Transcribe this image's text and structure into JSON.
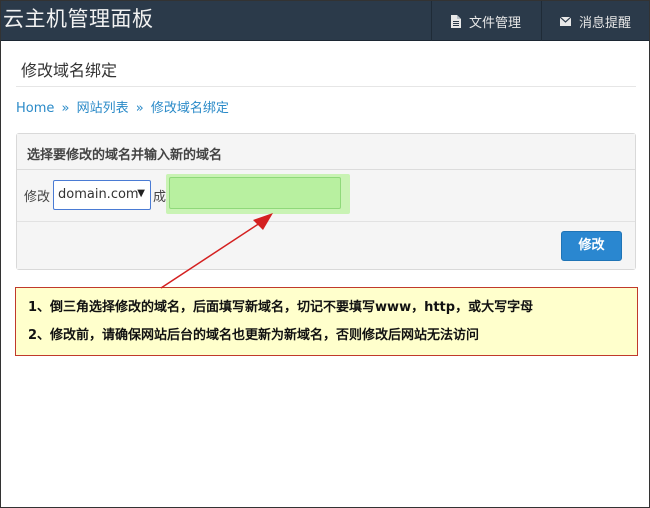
{
  "navbar": {
    "brand": "云主机管理面板",
    "files_label": "文件管理",
    "messages_label": "消息提醒"
  },
  "page": {
    "title": "修改域名绑定"
  },
  "breadcrumb": {
    "home": "Home",
    "sep1": "»",
    "sites": "网站列表",
    "sep2": "»",
    "current": "修改域名绑定"
  },
  "form": {
    "heading": "选择要修改的域名并输入新的域名",
    "modify_label": "修改",
    "selected_domain": "domain.com",
    "to_label": "成",
    "new_domain_value": "",
    "submit_label": "修改"
  },
  "notes": {
    "line1": "1、倒三角选择修改的域名，后面填写新域名，切记不要填写www，http，或大写字母",
    "line2": "2、修改前，请确保网站后台的域名也更新为新域名，否则修改后网站无法访问"
  },
  "colors": {
    "navbar_bg": "#2b3a4a",
    "link": "#2a8ac8",
    "button": "#2a87d0",
    "highlight_green": "#b8f0a0",
    "note_bg": "#ffffcc",
    "note_border": "#c0392b"
  },
  "icons": {
    "files": "document-icon",
    "messages": "envelope-icon",
    "select_caret": "triangle-down-icon",
    "annotation": "arrow-icon"
  }
}
